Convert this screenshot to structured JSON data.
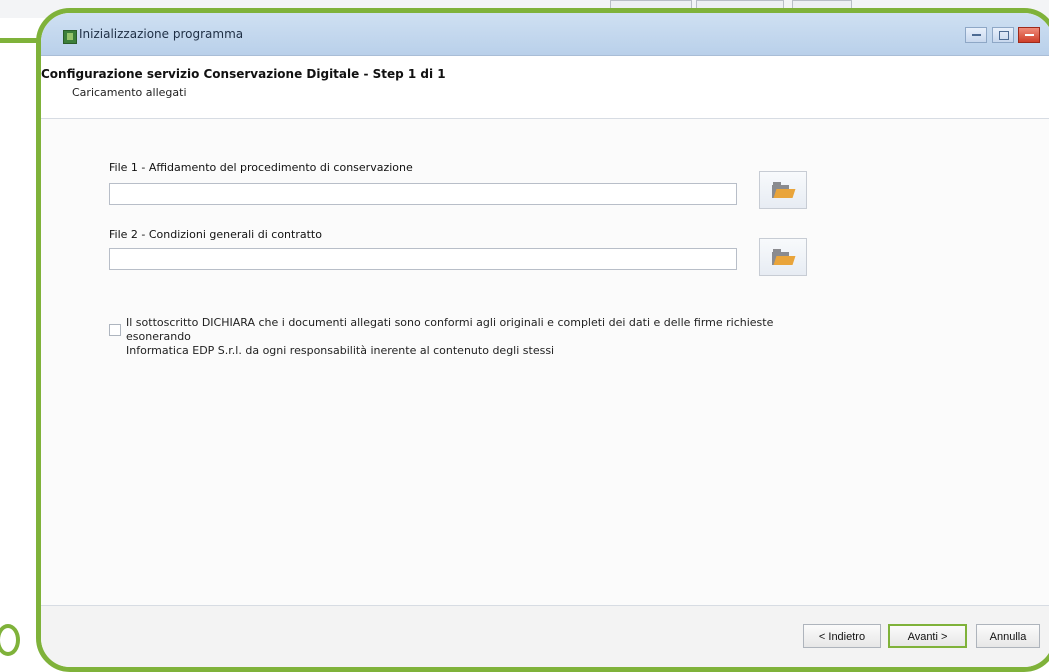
{
  "window": {
    "title": "Inizializzazione programma",
    "icon": "program-icon"
  },
  "header": {
    "step_title": "Configurazione servizio Conservazione Digitale - Step 1 di 1",
    "step_subtitle": "Caricamento allegati"
  },
  "files": [
    {
      "label": "File 1 - Affidamento del procedimento di conservazione",
      "value": "",
      "browse_icon": "folder-open-icon"
    },
    {
      "label": "File 2 - Condizioni generali di contratto",
      "value": "",
      "browse_icon": "folder-open-icon"
    }
  ],
  "declaration": {
    "checked": false,
    "line1": "Il sottoscritto DICHIARA che i documenti allegati sono conformi agli originali e completi dei dati e delle firme richieste esonerando",
    "line2": "Informatica EDP S.r.l. da ogni responsabilità inerente al contenuto degli stessi"
  },
  "buttons": {
    "back": "< Indietro",
    "next": "Avanti >",
    "cancel": "Annulla"
  },
  "colors": {
    "accent": "#7fb23a",
    "folder": "#e9a43a"
  }
}
